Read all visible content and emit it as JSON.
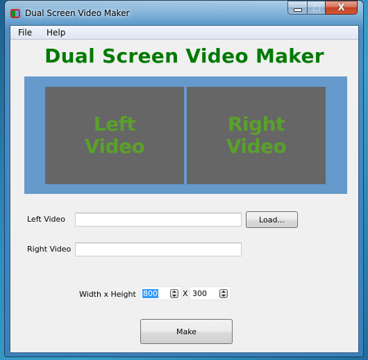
{
  "window": {
    "title": "Dual Screen Video Maker",
    "icon": "app-dual-screen-icon",
    "controls": {
      "minimize": "minimize-icon",
      "maximize": "maximize-icon",
      "close": "close-icon",
      "close_glyph": "X"
    }
  },
  "menu": {
    "items": [
      {
        "label": "File"
      },
      {
        "label": "Help"
      }
    ]
  },
  "heading": "Dual Screen Video Maker",
  "preview": {
    "background": "#6699cc",
    "pane_color": "#666666",
    "text_color": "#5aa02c",
    "left": {
      "line1": "Left",
      "line2": "Video"
    },
    "right": {
      "line1": "Right",
      "line2": "Video"
    }
  },
  "form": {
    "left_video": {
      "label": "Left Video",
      "value": ""
    },
    "load_button": "Load...",
    "right_video": {
      "label": "Right Video",
      "value": ""
    },
    "size": {
      "label": "Width x Height",
      "width": "800",
      "separator": "X",
      "height": "300"
    },
    "make_button": "Make"
  },
  "colors": {
    "heading": "#007a00",
    "selection": "#3399ff"
  }
}
